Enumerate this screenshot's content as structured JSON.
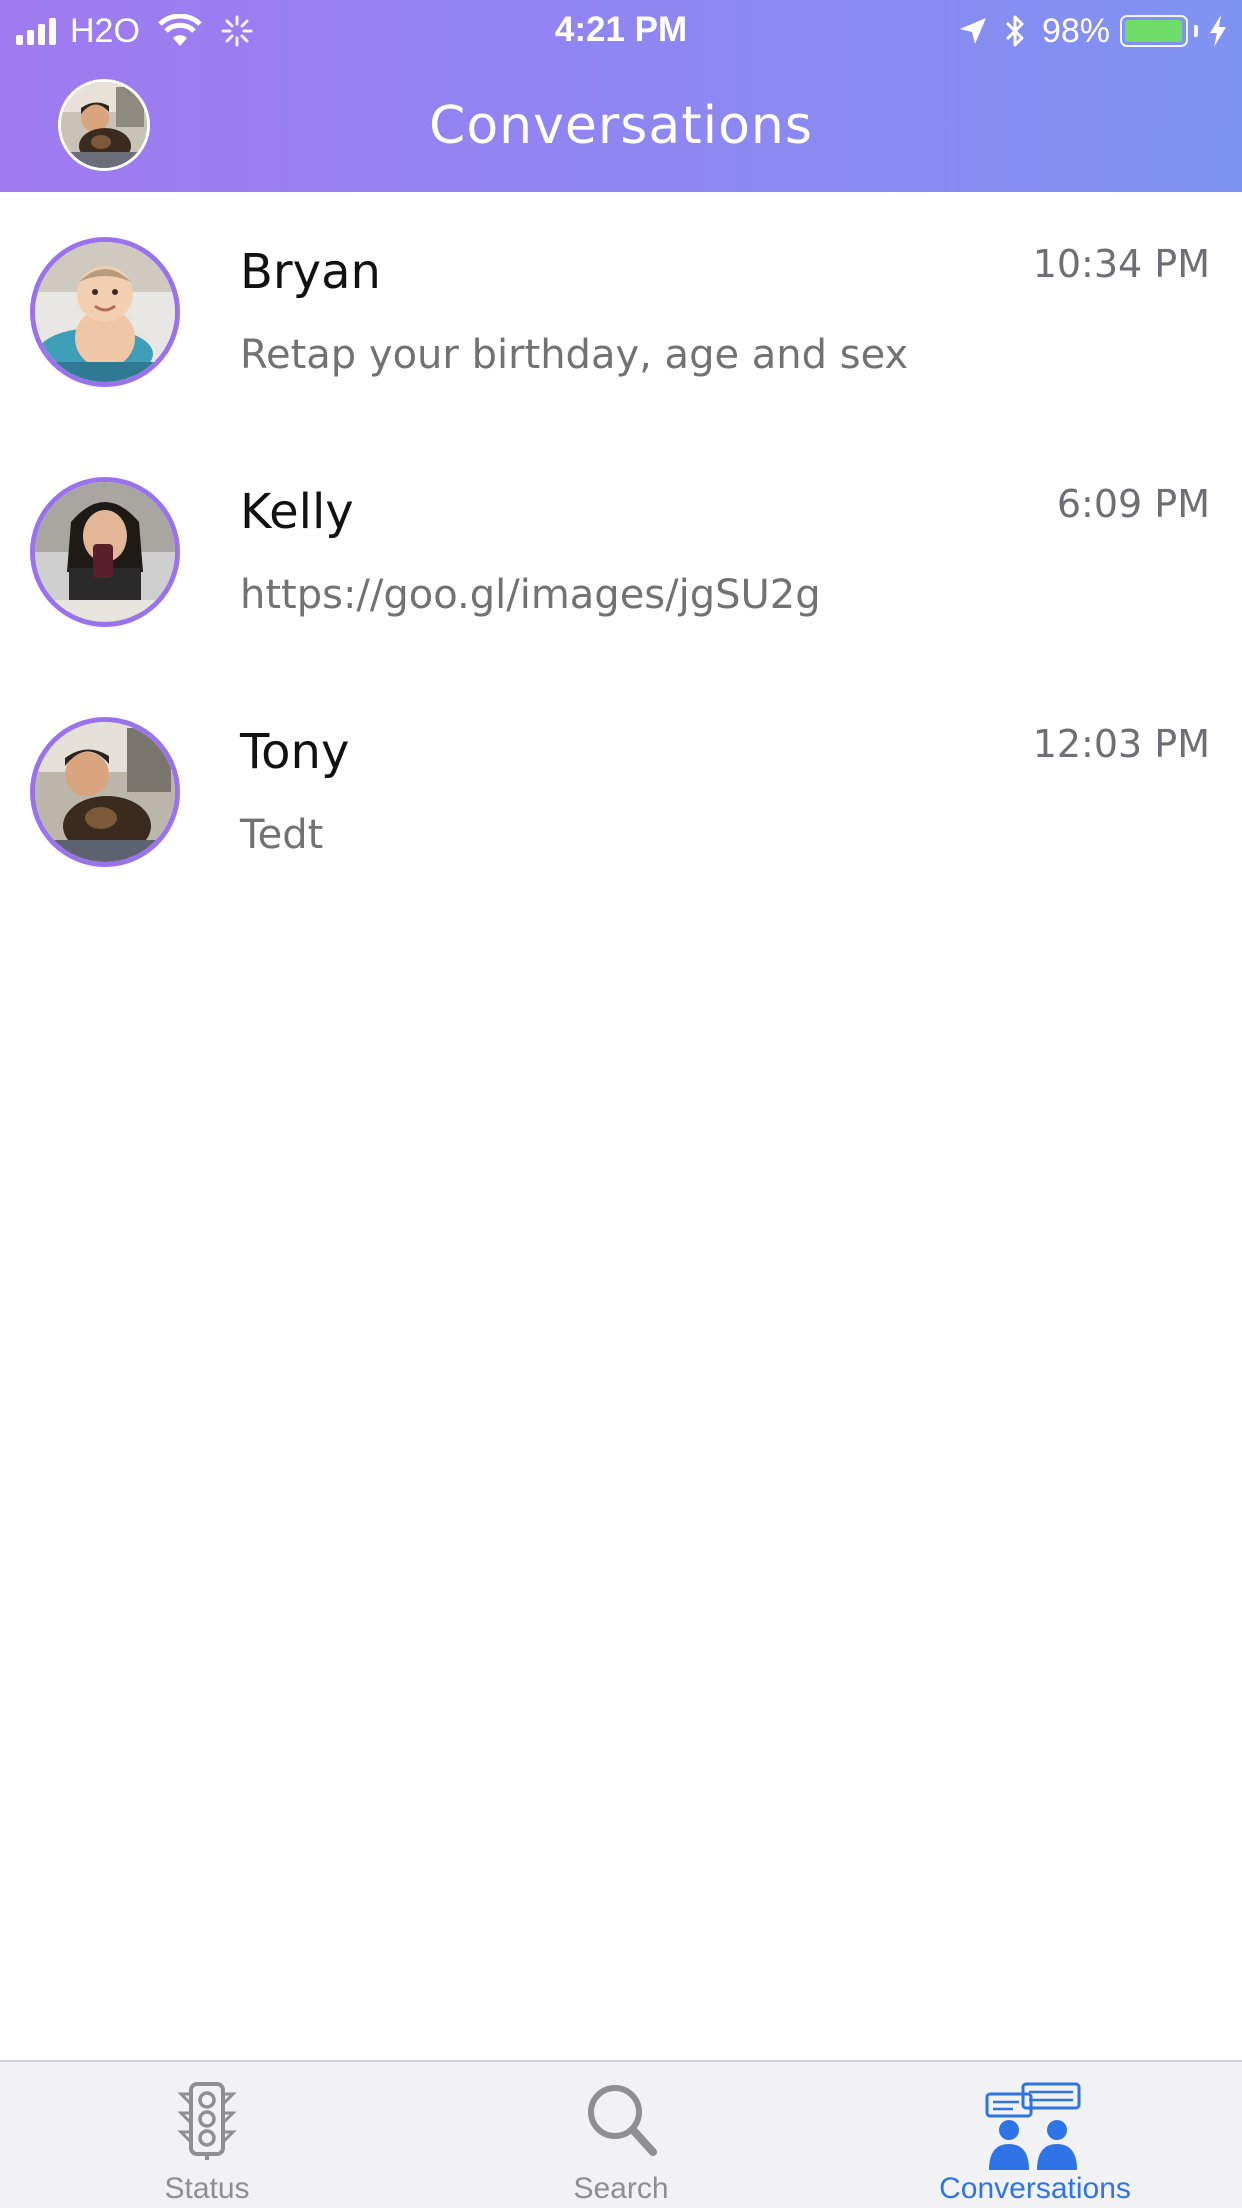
{
  "status_bar": {
    "carrier": "H2O",
    "time": "4:21 PM",
    "battery_percent": "98%",
    "battery_level": 0.98,
    "icons": [
      "signal-icon",
      "wifi-icon",
      "activity-spinner-icon",
      "location-arrow-icon",
      "bluetooth-icon",
      "battery-icon",
      "charging-bolt-icon"
    ]
  },
  "nav": {
    "title": "Conversations",
    "profile_avatar_icon": "profile-avatar"
  },
  "conversations": [
    {
      "name": "Bryan",
      "time": "10:34 PM",
      "message": "Retap your birthday, age and sex"
    },
    {
      "name": "Kelly",
      "time": "6:09 PM",
      "message": "https://goo.gl/images/jgSU2g"
    },
    {
      "name": "Tony",
      "time": "12:03 PM",
      "message": "Tedt"
    }
  ],
  "tabs": [
    {
      "label": "Status",
      "icon": "traffic-light-icon",
      "active": false
    },
    {
      "label": "Search",
      "icon": "search-icon",
      "active": false
    },
    {
      "label": "Conversations",
      "icon": "conversations-icon",
      "active": true
    }
  ],
  "colors": {
    "header_gradient_start": "#a07af0",
    "header_gradient_end": "#7f93f2",
    "avatar_ring": "#9a73ec",
    "tab_active": "#2f74e6",
    "tab_inactive": "#8e8e93"
  }
}
